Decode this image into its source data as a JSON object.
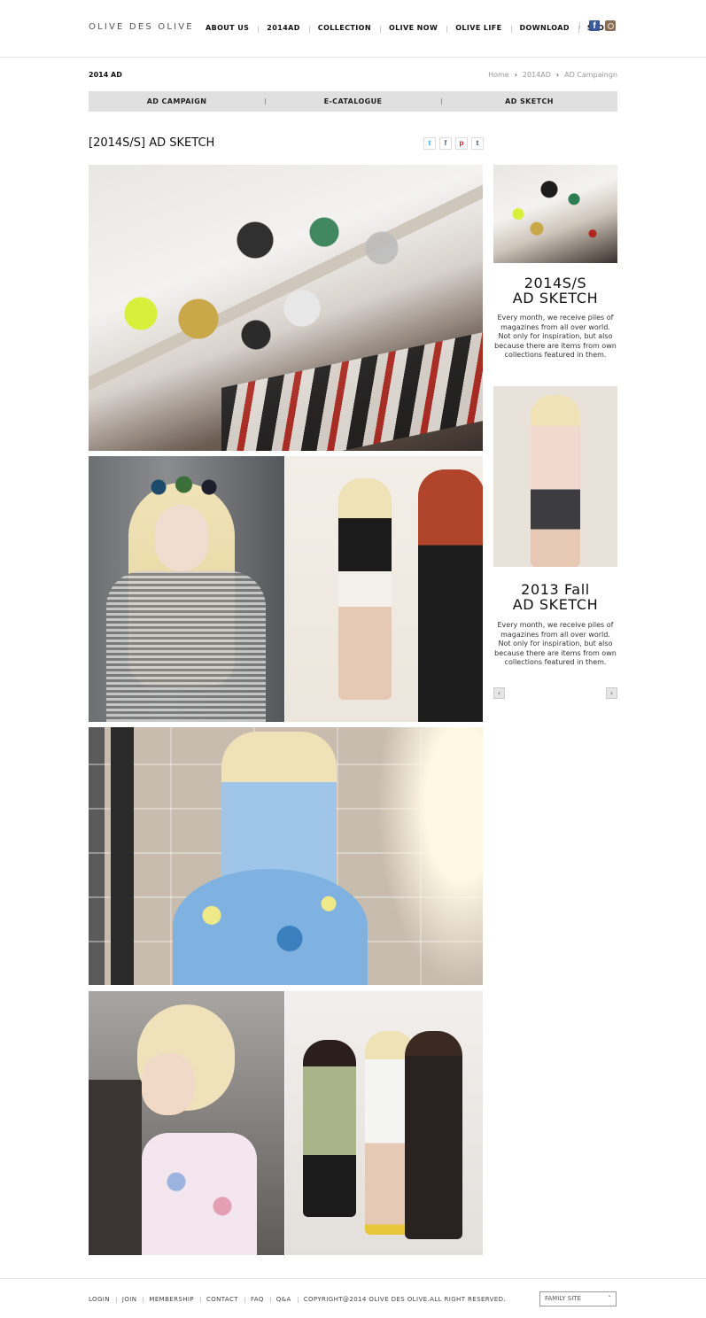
{
  "brand": {
    "logo": "OLIVE DES OLIVE"
  },
  "nav": {
    "items": [
      "ABOUT US",
      "2014AD",
      "COLLECTION",
      "OLIVE NOW",
      "OLIVE LIFE",
      "DOWNLOAD",
      "STORE"
    ],
    "social": [
      {
        "icon": "facebook-icon",
        "glyph": "f",
        "color": "#3b5998"
      },
      {
        "icon": "instagram-icon",
        "glyph": "",
        "color": "#8a6d55"
      }
    ]
  },
  "subheader": {
    "section_label": "2014 AD",
    "breadcrumb": [
      "Home",
      "2014AD",
      "AD Campaingn"
    ]
  },
  "tabs": [
    "AD CAMPAIGN",
    "E-CATALOGUE",
    "AD SKETCH"
  ],
  "page": {
    "title": "[2014S/S] AD SKETCH",
    "share": [
      {
        "icon": "twitter-icon",
        "glyph": "t"
      },
      {
        "icon": "facebook-icon",
        "glyph": "f"
      },
      {
        "icon": "pinterest-icon",
        "glyph": "p"
      },
      {
        "icon": "tumblr-icon",
        "glyph": "t"
      }
    ]
  },
  "sidebar": {
    "cards": [
      {
        "title_line1": "2014S/S",
        "title_line2": "AD SKETCH",
        "text_lines": [
          "Every month, we receive piles of",
          "magazines from all over world.",
          "Not only for inspiration, but also",
          "because there are items from own",
          "collections featured in them."
        ]
      },
      {
        "title_line1": "2013 Fall",
        "title_line2": "AD SKETCH",
        "text_lines": [
          "Every month, we receive piles of",
          "magazines from all over world.",
          "Not only for inspiration, but also",
          "because there are items from own",
          "collections featured in them."
        ]
      }
    ],
    "pager": {
      "prev": "‹",
      "next": "›"
    }
  },
  "footer": {
    "links": [
      "LOGIN",
      "JOIN",
      "MEMBERSHIP",
      "CONTACT",
      "FAQ",
      "Q&A",
      "COPYRIGHT@2014 OLIVE DES OLIVE.ALL RIGHT RESERVED."
    ],
    "family_site": "FAMILY SITE",
    "family_site_caret": "˅"
  }
}
